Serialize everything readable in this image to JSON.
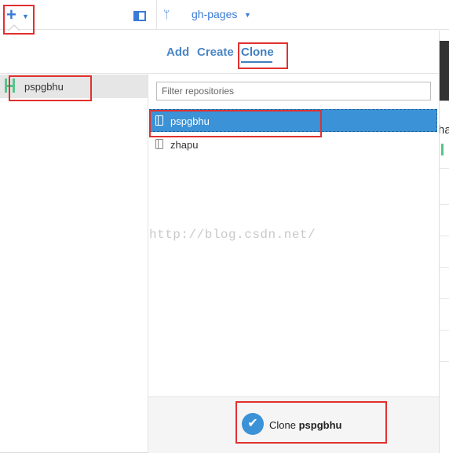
{
  "toolbar": {
    "add_icon": "plus-icon",
    "branch_icon": "branch-icon",
    "branch_name": "gh-pages"
  },
  "tabs": [
    "Add",
    "Create",
    "Clone"
  ],
  "active_tab": "Clone",
  "accounts": [
    {
      "label": "pspgbhu"
    }
  ],
  "filter": {
    "placeholder": "Filter repositories",
    "value": ""
  },
  "repositories": [
    {
      "label": "pspgbhu",
      "selected": true
    },
    {
      "label": "zhapu",
      "selected": false
    }
  ],
  "footer": {
    "clone_prefix": "Clone",
    "clone_repo": "pspgbhu"
  },
  "watermark": "http://blog.csdn.net/",
  "background_peek": {
    "text": "ha"
  },
  "colors": {
    "accent": "#3b92d6",
    "tab_blue": "#4a86c5",
    "annotation_red": "#e0312f",
    "github_green": "#57c48c"
  }
}
